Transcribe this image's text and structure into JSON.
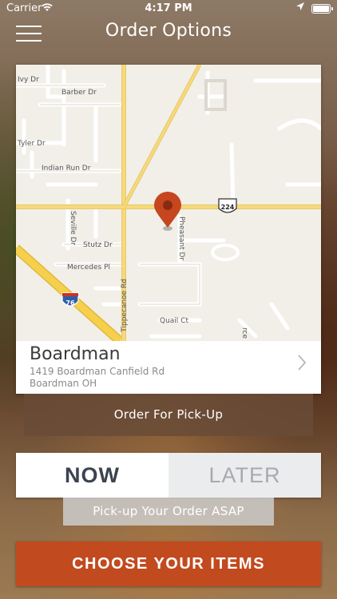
{
  "status_bar": {
    "carrier": "Carrier",
    "time": "4:17 PM"
  },
  "header": {
    "title": "Order Options"
  },
  "map": {
    "streets": {
      "ivy": "Ivy Dr",
      "barber": "Barber Dr",
      "tyler": "Tyler Dr",
      "indian_run": "Indian Run Dr",
      "seville": "Seville Dr",
      "stutz": "Stutz Dr",
      "mercedes": "Mercedes Pl",
      "pheasant": "Pheasant Dr",
      "tippecanoe": "Tippecanoe Rd",
      "quail": "Quail Ct",
      "spruce": "rce"
    },
    "route_224": "224",
    "route_76": "76",
    "pin_icon": "map-pin-icon"
  },
  "store": {
    "name": "Boardman",
    "address_line1": "1419 Boardman Canfield Rd",
    "address_line2": "Boardman OH",
    "chevron_icon": "chevron-right-icon"
  },
  "order_type": {
    "label": "Order For Pick-Up"
  },
  "timing": {
    "now_label": "NOW",
    "later_label": "LATER",
    "selected": "NOW",
    "note": "Pick-up Your Order ASAP"
  },
  "actions": {
    "choose_items": "CHOOSE YOUR ITEMS"
  },
  "colors": {
    "accent": "#c24a1f",
    "pin": "#c6461f",
    "road_major": "#f6d97a",
    "interstate": "#f6d04d"
  }
}
